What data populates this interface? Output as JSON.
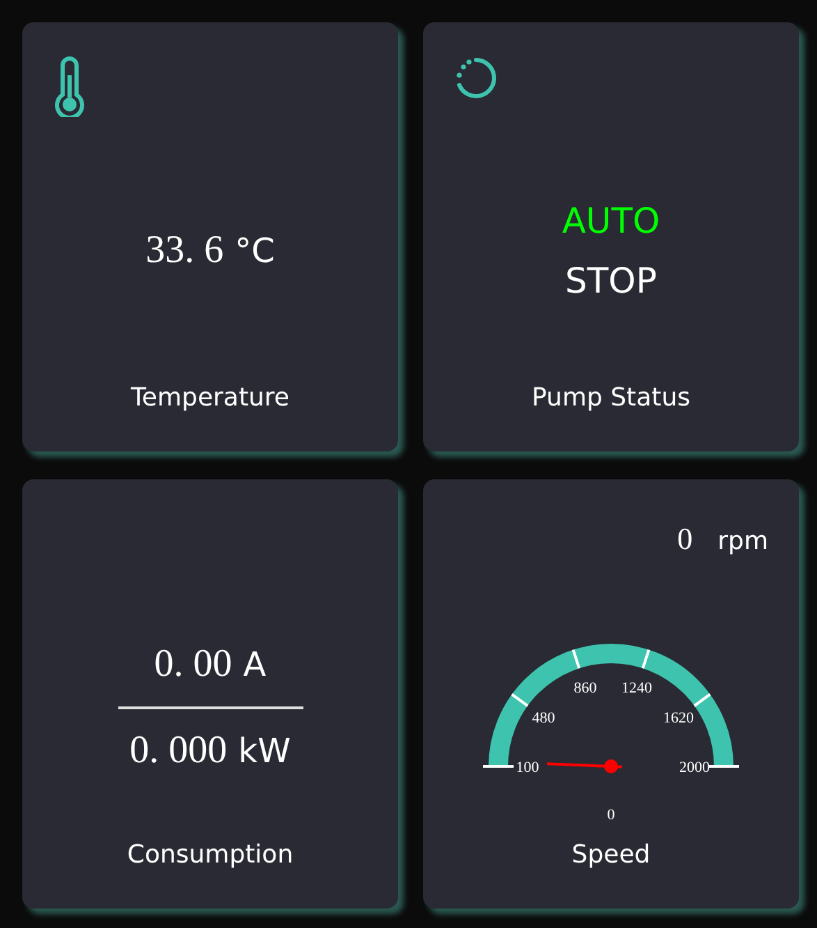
{
  "cards": [
    {
      "kind": "temperature",
      "label": "Temperature",
      "value": "33. 6",
      "unit": "°C"
    },
    {
      "kind": "status",
      "label": "Pump Status",
      "mode": "AUTO",
      "state": "STOP"
    },
    {
      "kind": "consumption",
      "label": "Consumption",
      "current": "0. 00",
      "current_unit": "A",
      "power": "0. 000",
      "power_unit": "kW"
    },
    {
      "kind": "speed",
      "label": "Speed",
      "value": "0",
      "unit": "rpm",
      "gauge": {
        "ticks": [
          "100",
          "480",
          "860",
          "1240",
          "1620",
          "2000"
        ],
        "reading": "0"
      }
    }
  ]
}
